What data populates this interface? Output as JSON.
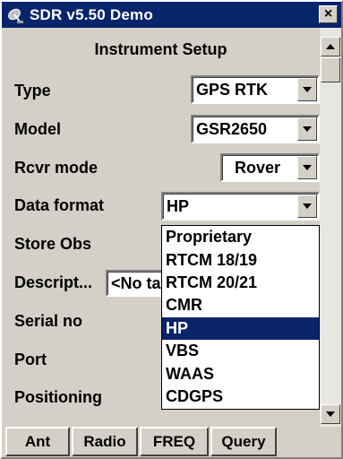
{
  "window": {
    "title": "SDR v5.50 Demo",
    "close_label": "×",
    "app_icon": "satellite-dish-icon"
  },
  "form": {
    "section_title": "Instrument Setup",
    "fields": {
      "type": {
        "label": "Type",
        "value": "GPS RTK"
      },
      "model": {
        "label": "Model",
        "value": "GSR2650"
      },
      "rcvr_mode": {
        "label": "Rcvr mode",
        "value": "Rover"
      },
      "data_format": {
        "label": "Data format",
        "value": "HP"
      },
      "store_obs": {
        "label": "Store Obs"
      },
      "descript": {
        "label": "Descript...",
        "value": "<No tag>"
      },
      "serial_no": {
        "label": "Serial no"
      },
      "port": {
        "label": "Port"
      },
      "positioning": {
        "label": "Positioning"
      }
    }
  },
  "dropdown": {
    "options": [
      "Proprietary",
      "RTCM 18/19",
      "RTCM 20/21",
      "CMR",
      "HP",
      "VBS",
      "WAAS",
      "CDGPS"
    ],
    "selected": "HP"
  },
  "bottom_buttons": {
    "ant": "Ant",
    "radio": "Radio",
    "freq": "FREQ",
    "query": "Query"
  },
  "colors": {
    "title_bar": "#08246b",
    "selection": "#0a246a",
    "face": "#d4d0c8"
  }
}
